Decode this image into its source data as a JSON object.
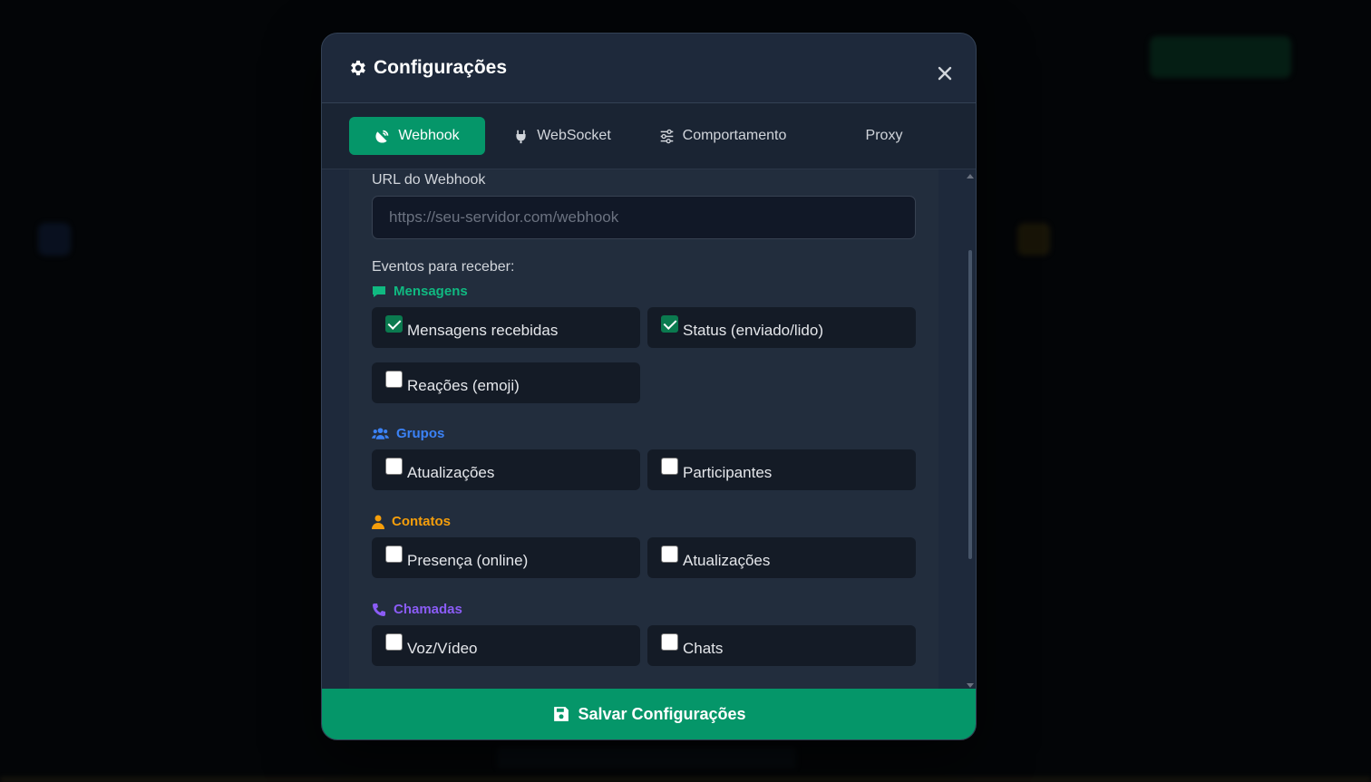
{
  "modal": {
    "title": "Configurações",
    "close_symbol": "✕"
  },
  "tabs": [
    {
      "label": "Webhook",
      "icon": "satellite-dish-icon",
      "active": true
    },
    {
      "label": "WebSocket",
      "icon": "plug-icon",
      "active": false
    },
    {
      "label": "Comportamento",
      "icon": "sliders-icon",
      "active": false
    },
    {
      "label": "Proxy",
      "icon": "",
      "active": false
    }
  ],
  "webhook": {
    "url_label": "URL do Webhook",
    "url_value": "",
    "url_placeholder": "https://seu-servidor.com/webhook",
    "events_label": "Eventos para receber:"
  },
  "groups": {
    "mensagens": {
      "title": "Mensagens",
      "icon": "comment-icon",
      "color": "#10b981",
      "items": [
        {
          "label": "Mensagens recebidas",
          "checked": true
        },
        {
          "label": "Status (enviado/lido)",
          "checked": true
        },
        {
          "label": "Reações (emoji)",
          "checked": false
        }
      ]
    },
    "grupos": {
      "title": "Grupos",
      "icon": "users-icon",
      "color": "#3b82f6",
      "items": [
        {
          "label": "Atualizações",
          "checked": false
        },
        {
          "label": "Participantes",
          "checked": false
        }
      ]
    },
    "contatos": {
      "title": "Contatos",
      "icon": "user-icon",
      "color": "#f59e0b",
      "items": [
        {
          "label": "Presença (online)",
          "checked": false
        },
        {
          "label": "Atualizações",
          "checked": false
        }
      ]
    },
    "chamadas": {
      "title": "Chamadas",
      "icon": "phone-icon",
      "color": "#8b5cf6",
      "items": [
        {
          "label": "Voz/Vídeo",
          "checked": false
        },
        {
          "label": "Chats",
          "checked": false
        }
      ]
    }
  },
  "save_button": {
    "label": "Salvar Configurações",
    "icon": "floppy-disk-icon"
  },
  "colors": {
    "accent": "#059669",
    "modal_bg": "#1e293b",
    "card_bg": "#141b26"
  }
}
